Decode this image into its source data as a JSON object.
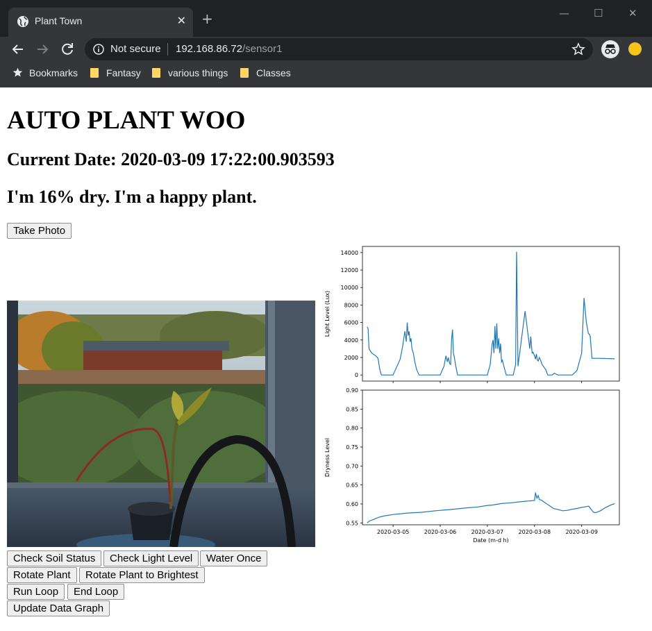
{
  "browser": {
    "tab_title": "Plant Town",
    "new_tab_symbol": "+",
    "close_symbol": "✕",
    "url": {
      "security_label": "Not secure",
      "host": "192.168.86.72",
      "path": "/sensor1"
    },
    "bookmarks": [
      "Bookmarks",
      "Fantasy",
      "various things",
      "Classes"
    ],
    "icons": [
      "globe-icon",
      "back-icon",
      "forward-icon",
      "reload-icon",
      "info-icon",
      "star-icon",
      "incognito-icon",
      "extension-icon",
      "minimize-icon",
      "maximize-icon",
      "close-icon"
    ]
  },
  "page": {
    "title": "AUTO PLANT WOO",
    "current_date": "Current Date: 2020-03-09 17:22:00.903593",
    "status": "I'm 16% dry. I'm a happy plant.",
    "take_photo_label": "Take Photo",
    "buttons": {
      "check_soil": "Check Soil Status",
      "check_light": "Check Light Level",
      "water_once": "Water Once",
      "rotate": "Rotate Plant",
      "rotate_brightest": "Rotate Plant to Brightest",
      "run_loop": "Run Loop",
      "end_loop": "End Loop",
      "update_graph": "Update Data Graph"
    }
  },
  "chart_data": [
    {
      "type": "line",
      "xlabel": "",
      "ylabel": "Light Level (Lux)",
      "ylim": [
        -700,
        14700
      ],
      "yticks": [
        "0",
        "2000",
        "4000",
        "6000",
        "8000",
        "10000",
        "12000",
        "14000"
      ],
      "xlim": [
        4.35,
        9.8
      ],
      "color": "#1f77b4",
      "series": [
        {
          "x": [
            4.45,
            4.47,
            4.49,
            4.51,
            4.55,
            4.6,
            4.65,
            4.68,
            4.72,
            4.75,
            4.8,
            5.0,
            5.15,
            5.2,
            5.25,
            5.28,
            5.3,
            5.32,
            5.34,
            5.36,
            5.38,
            5.4,
            5.43,
            5.46,
            5.5,
            5.55,
            5.6,
            6.0,
            6.08,
            6.12,
            6.15,
            6.17,
            6.2,
            6.22,
            6.24,
            6.26,
            6.28,
            6.3,
            6.33,
            6.37,
            6.4,
            7.0,
            7.06,
            7.1,
            7.12,
            7.14,
            7.16,
            7.18,
            7.2,
            7.22,
            7.24,
            7.26,
            7.28,
            7.3,
            7.32,
            7.35,
            7.4,
            7.45,
            7.5,
            7.55,
            7.6,
            7.62,
            7.65,
            7.8,
            7.9,
            7.92,
            7.95,
            7.97,
            8.0,
            8.02,
            8.04,
            8.06,
            8.08,
            8.1,
            8.13,
            8.16,
            8.2,
            8.24,
            8.28,
            8.32,
            8.36,
            8.38,
            8.42,
            8.5,
            8.55,
            8.6,
            8.65,
            8.7,
            8.75,
            8.8,
            8.9,
            9.0,
            9.05,
            9.1,
            9.14,
            9.18,
            9.22,
            9.24,
            9.27,
            9.3,
            9.35,
            9.7
          ],
          "y": [
            5500,
            5300,
            3000,
            2800,
            2500,
            2300,
            2100,
            1900,
            600,
            0,
            0,
            0,
            1800,
            3200,
            5000,
            3800,
            6000,
            4500,
            5000,
            3800,
            4200,
            3000,
            2500,
            1500,
            600,
            0,
            0,
            0,
            1000,
            2200,
            1500,
            2000,
            1300,
            1200,
            4000,
            5200,
            2500,
            2000,
            1000,
            0,
            0,
            0,
            1200,
            3500,
            4000,
            2500,
            5600,
            3000,
            5900,
            3000,
            4200,
            2500,
            3600,
            1500,
            1700,
            1000,
            0,
            0,
            0,
            0,
            1200,
            14100,
            1000,
            7300,
            3000,
            4400,
            2500,
            2600,
            2200,
            1800,
            2400,
            1700,
            1600,
            2000,
            1700,
            1200,
            900,
            600,
            0,
            0,
            0,
            0,
            200,
            0,
            0,
            0,
            0,
            0,
            0,
            0,
            500,
            2500,
            8800,
            6000,
            4800,
            4500,
            1900,
            1900,
            1900,
            1900,
            1900,
            1850
          ]
        }
      ]
    },
    {
      "type": "line",
      "xlabel": "Date (m-d h)",
      "ylabel": "Dryness Level",
      "ylim": [
        0.545,
        0.9
      ],
      "yticks": [
        "0.55",
        "0.60",
        "0.65",
        "0.70",
        "0.75",
        "0.80",
        "0.85",
        "0.90"
      ],
      "xlim": [
        4.35,
        9.8
      ],
      "xticks": [
        "2020-03-05",
        "2020-03-06",
        "2020-03-07",
        "2020-03-08",
        "2020-03-09"
      ],
      "color": "#1f77b4",
      "series": [
        {
          "x": [
            4.45,
            4.5,
            4.6,
            4.7,
            4.8,
            5.0,
            5.3,
            5.6,
            5.9,
            6.2,
            6.5,
            6.8,
            7.0,
            7.1,
            7.2,
            7.3,
            7.5,
            7.8,
            8.0,
            8.02,
            8.05,
            8.08,
            8.1,
            8.12,
            8.15,
            8.2,
            8.3,
            8.4,
            8.5,
            8.6,
            8.7,
            8.8,
            8.9,
            9.0,
            9.1,
            9.15,
            9.2,
            9.25,
            9.3,
            9.4,
            9.5,
            9.6,
            9.7
          ],
          "y": [
            0.55,
            0.555,
            0.56,
            0.565,
            0.568,
            0.572,
            0.576,
            0.578,
            0.582,
            0.585,
            0.589,
            0.592,
            0.596,
            0.597,
            0.599,
            0.601,
            0.603,
            0.607,
            0.609,
            0.63,
            0.615,
            0.622,
            0.612,
            0.611,
            0.61,
            0.605,
            0.597,
            0.588,
            0.585,
            0.582,
            0.583,
            0.586,
            0.588,
            0.591,
            0.593,
            0.594,
            0.586,
            0.578,
            0.577,
            0.582,
            0.59,
            0.596,
            0.601
          ]
        }
      ]
    }
  ]
}
